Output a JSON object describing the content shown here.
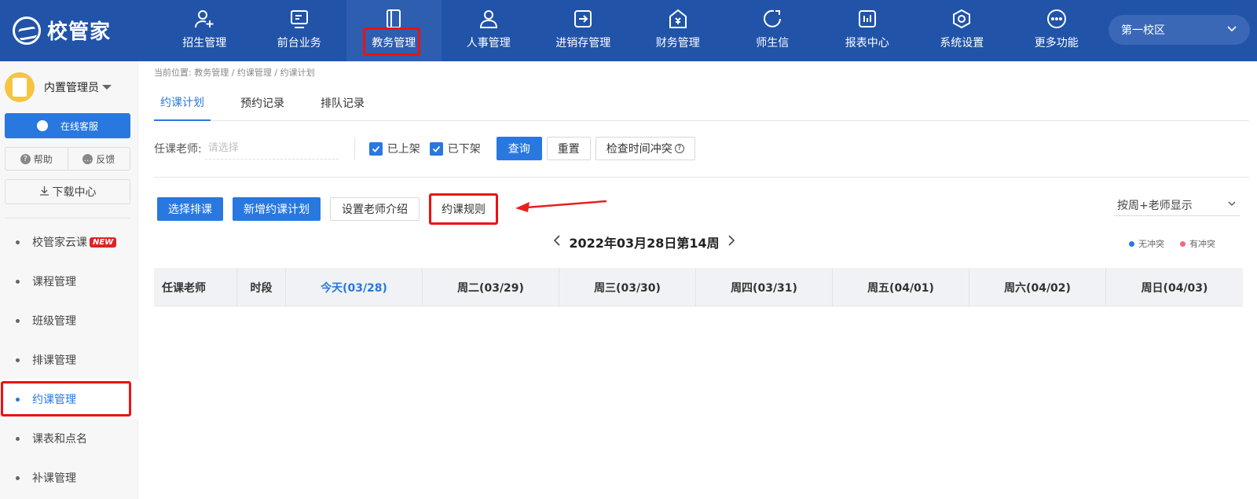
{
  "app": {
    "logo_text": "校管家"
  },
  "nav": [
    {
      "label": "招生管理",
      "icon": "user-add-icon"
    },
    {
      "label": "前台业务",
      "icon": "monitor-icon"
    },
    {
      "label": "教务管理",
      "icon": "book-icon"
    },
    {
      "label": "人事管理",
      "icon": "person-icon"
    },
    {
      "label": "进销存管理",
      "icon": "inventory-icon"
    },
    {
      "label": "财务管理",
      "icon": "finance-icon"
    },
    {
      "label": "师生信",
      "icon": "message-icon"
    },
    {
      "label": "报表中心",
      "icon": "report-icon"
    },
    {
      "label": "系统设置",
      "icon": "settings-icon"
    },
    {
      "label": "更多功能",
      "icon": "more-icon"
    }
  ],
  "campus": {
    "selected": "第一校区"
  },
  "sidebar": {
    "user_name": "内置管理员",
    "service_label": "在线客服",
    "help_label": "帮助",
    "feedback_label": "反馈",
    "download_label": "下载中心",
    "menu": [
      {
        "label": "校管家云课",
        "badge": "NEW"
      },
      {
        "label": "课程管理"
      },
      {
        "label": "班级管理"
      },
      {
        "label": "排课管理"
      },
      {
        "label": "约课管理"
      },
      {
        "label": "课表和点名"
      },
      {
        "label": "补课管理"
      }
    ]
  },
  "breadcrumb": "当前位置: 教务管理 / 约课管理 / 约课计划",
  "tabs": [
    "约课计划",
    "预约记录",
    "排队记录"
  ],
  "filter": {
    "teacher_label": "任课老师:",
    "teacher_placeholder": "请选择",
    "on_shelf_label": "已上架",
    "off_shelf_label": "已下架",
    "query_label": "查询",
    "reset_label": "重置",
    "conflict_check_label": "检查时间冲突"
  },
  "actions": {
    "select_schedule": "选择排课",
    "add_plan": "新增约课计划",
    "teacher_intro": "设置老师介绍",
    "rules": "约课规则"
  },
  "view_select": "按周+老师显示",
  "week_title": "2022年03月28日第14周",
  "legend": {
    "no_conflict": "无冲突",
    "no_conflict_color": "#2878e0",
    "conflict": "有冲突",
    "conflict_color": "#f06a7a"
  },
  "table_headers": [
    "任课老师",
    "时段",
    "今天(03/28)",
    "周二(03/29)",
    "周三(03/30)",
    "周四(03/31)",
    "周五(04/01)",
    "周六(04/02)",
    "周日(04/03)"
  ]
}
